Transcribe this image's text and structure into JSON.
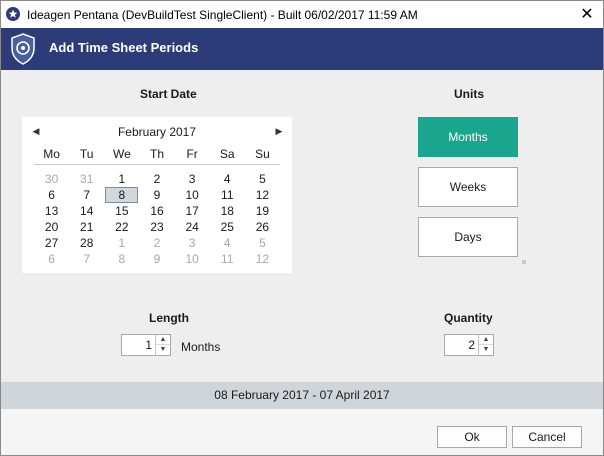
{
  "window": {
    "title": "Ideagen Pentana (DevBuildTest SingleClient) - Built 06/02/2017 11:59 AM",
    "close_glyph": "✕"
  },
  "header": {
    "title": "Add Time Sheet Periods"
  },
  "start_date": {
    "label": "Start Date",
    "calendar": {
      "month_label": "February 2017",
      "prev_glyph": "◀",
      "next_glyph": "▶",
      "weekdays": [
        "Mo",
        "Tu",
        "We",
        "Th",
        "Fr",
        "Sa",
        "Su"
      ],
      "days": [
        {
          "d": "30",
          "other": true
        },
        {
          "d": "31",
          "other": true
        },
        {
          "d": "1"
        },
        {
          "d": "2"
        },
        {
          "d": "3"
        },
        {
          "d": "4"
        },
        {
          "d": "5"
        },
        {
          "d": "6"
        },
        {
          "d": "7"
        },
        {
          "d": "8",
          "selected": true
        },
        {
          "d": "9"
        },
        {
          "d": "10"
        },
        {
          "d": "11"
        },
        {
          "d": "12"
        },
        {
          "d": "13"
        },
        {
          "d": "14"
        },
        {
          "d": "15"
        },
        {
          "d": "16"
        },
        {
          "d": "17"
        },
        {
          "d": "18"
        },
        {
          "d": "19"
        },
        {
          "d": "20"
        },
        {
          "d": "21"
        },
        {
          "d": "22"
        },
        {
          "d": "23"
        },
        {
          "d": "24"
        },
        {
          "d": "25"
        },
        {
          "d": "26"
        },
        {
          "d": "27"
        },
        {
          "d": "28"
        },
        {
          "d": "1",
          "other": true
        },
        {
          "d": "2",
          "other": true
        },
        {
          "d": "3",
          "other": true
        },
        {
          "d": "4",
          "other": true
        },
        {
          "d": "5",
          "other": true
        },
        {
          "d": "6",
          "other": true
        },
        {
          "d": "7",
          "other": true
        },
        {
          "d": "8",
          "other": true
        },
        {
          "d": "9",
          "other": true
        },
        {
          "d": "10",
          "other": true
        },
        {
          "d": "11",
          "other": true
        },
        {
          "d": "12",
          "other": true
        }
      ]
    }
  },
  "units": {
    "label": "Units",
    "options": [
      "Months",
      "Weeks",
      "Days"
    ],
    "selected": "Months"
  },
  "length": {
    "label": "Length",
    "value": "1",
    "unit_label": "Months"
  },
  "quantity": {
    "label": "Quantity",
    "value": "2"
  },
  "summary": "08 February 2017 - 07 April 2017",
  "buttons": {
    "ok": "Ok",
    "cancel": "Cancel"
  },
  "spinner_glyphs": {
    "up": "▲",
    "down": "▼"
  },
  "colors": {
    "header_bg": "#2b3c78",
    "accent": "#1aa58e",
    "summary_bg": "#d0d5da"
  }
}
